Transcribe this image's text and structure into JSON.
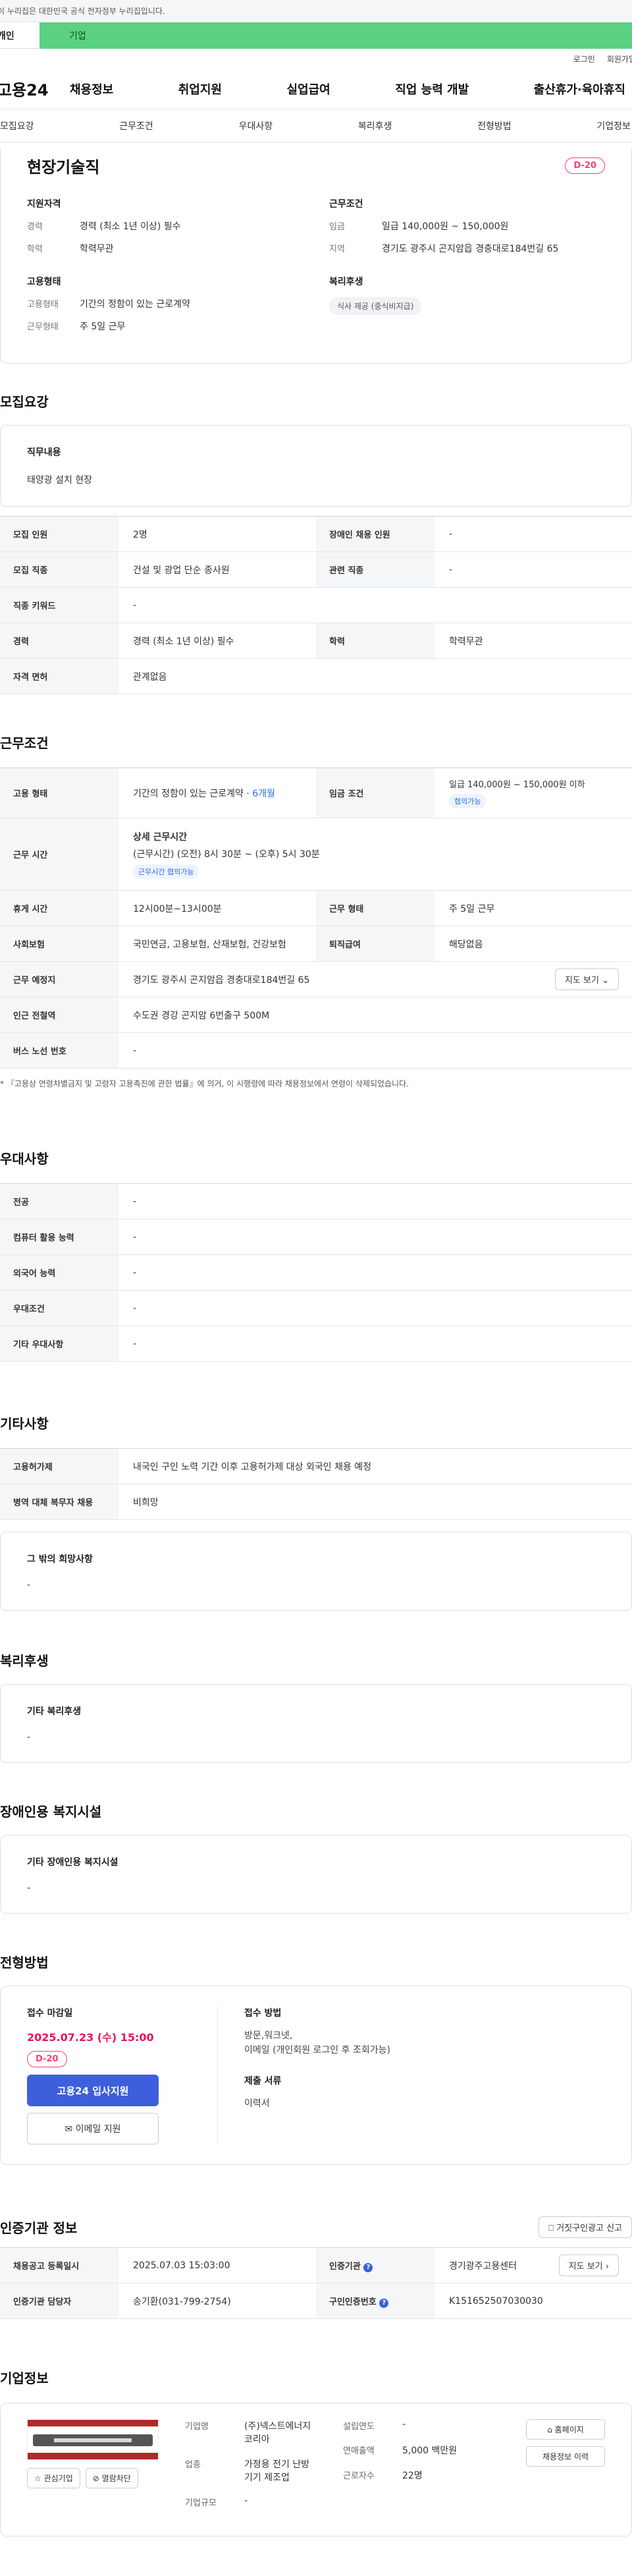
{
  "gov_bar": {
    "text": "이 누리집은 대한민국 공식 전자정부 누리집입니다."
  },
  "login_switch": {
    "personal": "개인",
    "corporate": "기업"
  },
  "util": {
    "login": "로그인",
    "signup": "회원가입"
  },
  "gnb": {
    "logo": "고용24",
    "menu": [
      "채용정보",
      "취업지원",
      "실업급여",
      "직업 능력 개발",
      "출산휴가·육아휴직"
    ]
  },
  "tabs": [
    "모집요강",
    "근무조건",
    "우대사항",
    "복리후생",
    "전형방법",
    "기업정보"
  ],
  "summary": {
    "title": "현장기술직",
    "dday": "D-20",
    "qualification": {
      "heading": "지원자격",
      "career_label": "경력",
      "career_value": "경력 (최소 1년 이상) 필수",
      "edu_label": "학력",
      "edu_value": "학력무관"
    },
    "employment": {
      "heading": "고용형태",
      "type_label": "고용형태",
      "type_value": "기간의 정함이 있는 근로계약",
      "shape_label": "근무형태",
      "shape_value": "주 5일 근무"
    },
    "conditions": {
      "heading": "근무조건",
      "wage_label": "임금",
      "wage_value": "일급 140,000원 ~ 150,000원",
      "region_label": "지역",
      "region_value": "경기도 광주시 곤지암읍 경충대로184번길 65"
    },
    "welfare": {
      "heading": "복리후생",
      "chip": "식사 제공 (중식비지급)"
    }
  },
  "recruit": {
    "heading": "모집요강",
    "duty_title": "직무내용",
    "duty_text": "태양광 설치 현장",
    "rows": {
      "count_label": "모집 인원",
      "count_value": "2명",
      "disabled_label": "장애인 채용 인원",
      "disabled_value": "-",
      "job_label": "모집 직종",
      "job_value": "건설 및 광업 단순 종사원",
      "related_label": "관련 직종",
      "related_value": "-",
      "keyword_label": "직종 키워드",
      "keyword_value": "-",
      "career_label": "경력",
      "career_value": "경력 (최소 1년 이상) 필수",
      "edu_label": "학력",
      "edu_value": "학력무관",
      "license_label": "자격 면허",
      "license_value": "관계없음"
    }
  },
  "work": {
    "heading": "근무조건",
    "type_label": "고용 형태",
    "type_value": "기간의 정함이 있는 근로계약 · ",
    "type_months": "6개월",
    "wage_label": "임금 조건",
    "wage_value": "일급 140,000원 ~ 150,000원 이하",
    "wage_chip": "협의가능",
    "time_label": "근무 시간",
    "time_title": "상세 근무시간",
    "time_value": "(근무시간) (오전) 8시 30분 ~ (오후) 5시 30분",
    "time_chip": "근무시간 협의가능",
    "break_label": "휴게 시간",
    "break_value": "12시00분~13시00분",
    "shape_label": "근무 형태",
    "shape_value": "주 5일 근무",
    "insurance_label": "사회보험",
    "insurance_value": "국민연금, 고용보험, 산재보험, 건강보험",
    "severance_label": "퇴직급여",
    "severance_value": "해당없음",
    "location_label": "근무 예정지",
    "location_value": "경기도 광주시 곤지암읍 경충대로184번길 65",
    "map_button": "지도 보기",
    "station_label": "인근 전철역",
    "station_value": "수도권 경강 곤지암 6번출구 500M",
    "bus_label": "버스 노선 번호",
    "bus_value": "-",
    "note": "* 『고용상 연령차별금지 및 고령자 고용촉진에 관한 법률』에 의거, 이 시행령에 따라 채용정보에서 연령이 삭제되었습니다."
  },
  "preference": {
    "heading": "우대사항",
    "rows": [
      {
        "label": "전공",
        "value": "-"
      },
      {
        "label": "컴퓨터 활용 능력",
        "value": "-"
      },
      {
        "label": "외국어 능력",
        "value": "-"
      },
      {
        "label": "우대조건",
        "value": "-"
      },
      {
        "label": "기타 우대사항",
        "value": "-"
      }
    ]
  },
  "etc": {
    "heading": "기타사항",
    "foreign_label": "고용허가제",
    "foreign_value": "내국인 구인 노력 기간 이후 고용허가제 대상 외국인 채용 예정",
    "military_label": "병역 대체 복무자 채용",
    "military_value": "비희망",
    "other_title": "그 밖의 희망사항",
    "other_value": "-"
  },
  "welfare": {
    "heading": "복리후생",
    "title": "기타 복리후생",
    "value": "-"
  },
  "facility": {
    "heading": "장애인용 복지시설",
    "title": "기타 장애인용 복지시설",
    "value": "-"
  },
  "selection": {
    "heading": "전형방법",
    "deadline_title": "접수 마감일",
    "deadline": "2025.07.23 (수) 15:00",
    "dday": "D-20",
    "apply_button": "고용24 입사지원",
    "email_button": "이메일 지원",
    "method_title": "접수 방법",
    "method_text1": "방문,워크넷,",
    "method_text2": "이메일 (개인회원 로그인 후 조회가능)",
    "docs_title": "제출 서류",
    "docs_text": "이력서"
  },
  "auth": {
    "heading": "인증기관 정보",
    "report_button": "거짓구인광고 신고",
    "date_label": "채용공고 등록일시",
    "date_value": "2025.07.03 15:03:00",
    "org_label": "인증기관",
    "org_value": "경기광주고용센터",
    "map_button": "지도 보기",
    "manager_label": "인증기관 담당자",
    "manager_value": "송기환(031-799-2754)",
    "number_label": "구인인증번호",
    "number_value": "K151652507030030"
  },
  "company": {
    "heading": "기업정보",
    "interest_button": "관심기업",
    "block_button": "열람차단",
    "name_label": "기업명",
    "name_value1": "(주)넥스트에너지",
    "name_value2": "코리아",
    "industry_label": "업종",
    "industry_value1": "가정용 전기 난방",
    "industry_value2": "기기 제조업",
    "size_label": "기업규모",
    "size_value": "-",
    "founded_label": "설립연도",
    "founded_value": "-",
    "sales_label": "연매출액",
    "sales_value": "5,000 백만원",
    "employees_label": "근로자수",
    "employees_value": "22명",
    "home_button": "홈페이지",
    "history_button": "채용정보 이력"
  }
}
